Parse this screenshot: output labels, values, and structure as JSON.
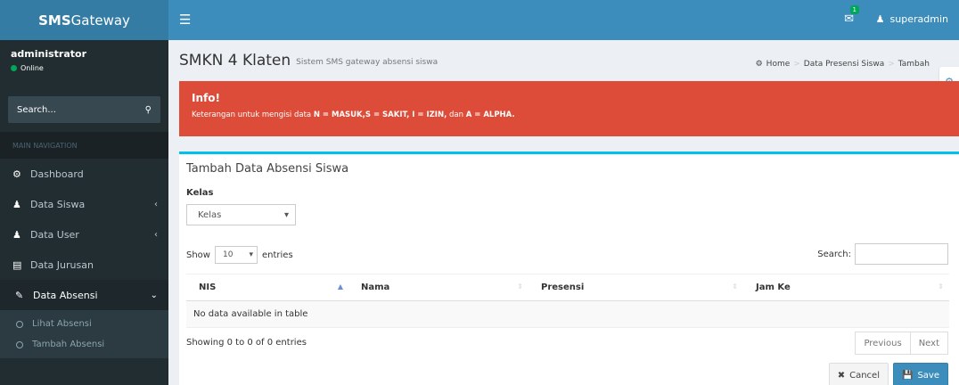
{
  "header": {
    "logo_bold": "SMS",
    "logo_rest": "Gateway",
    "mail_count": "1",
    "username": "superadmin"
  },
  "sidebar": {
    "user": "administrator",
    "status": "Online",
    "search_placeholder": "Search...",
    "nav_header": "MAIN NAVIGATION",
    "items": [
      {
        "label": "Dashboard"
      },
      {
        "label": "Data Siswa"
      },
      {
        "label": "Data User"
      },
      {
        "label": "Data Jurusan"
      },
      {
        "label": "Data Absensi"
      }
    ],
    "subitems": [
      {
        "label": "Lihat Absensi"
      },
      {
        "label": "Tambah Absensi"
      }
    ]
  },
  "content": {
    "title": "SMKN 4 Klaten",
    "subtitle": "Sistem SMS gateway absensi siswa",
    "breadcrumb": [
      "Home",
      "Data Presensi Siswa",
      "Tambah"
    ]
  },
  "callout": {
    "title": "Info!",
    "text_prefix": "Keterangan untuk mengisi data ",
    "text_bold": "N = MASUK,S = SAKIT, I = IZIN,",
    "text_mid": " dan ",
    "text_bold2": "A = ALPHA."
  },
  "box": {
    "title": "Tambah Data Absensi Siswa",
    "kelas_label": "Kelas",
    "kelas_value": "Kelas",
    "show_label": "Show",
    "page_length": "10",
    "entries_label": "entries",
    "search_label": "Search:",
    "columns": [
      "NIS",
      "Nama",
      "Presensi",
      "Jam Ke"
    ],
    "empty_text": "No data available in table",
    "info": "Showing 0 to 0 of 0 entries",
    "prev": "Previous",
    "next": "Next",
    "cancel": "Cancel",
    "save": "Save"
  },
  "colors": {
    "header": "#3c8dbc",
    "logo": "#357ca5",
    "sidebar": "#222d32",
    "callout": "#dd4b39",
    "box_border": "#00c0ef"
  }
}
